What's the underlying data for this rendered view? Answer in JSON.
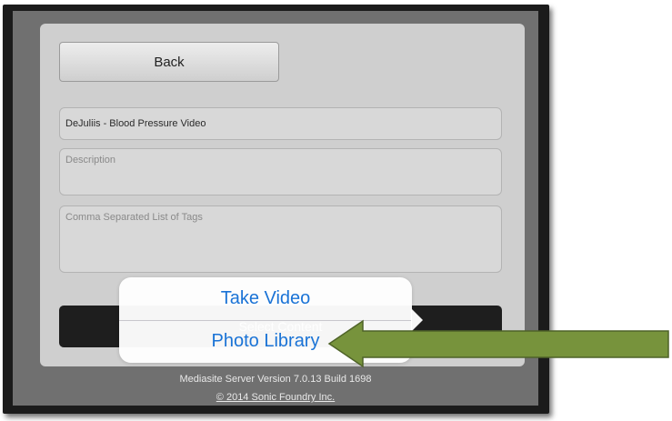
{
  "form": {
    "back_label": "Back",
    "title_value": "DeJuliis - Blood Pressure Video",
    "description_placeholder": "Description",
    "tags_placeholder": "Comma Separated List of Tags",
    "select_button_label": "Select Content"
  },
  "popover": {
    "items": [
      "Take Video",
      "Photo Library"
    ]
  },
  "footer": {
    "version": "Mediasite Server Version 7.0.13 Build 1698",
    "copyright": "© 2014 Sonic Foundry Inc."
  },
  "annotation": {
    "arrow_color": "#77933c"
  }
}
